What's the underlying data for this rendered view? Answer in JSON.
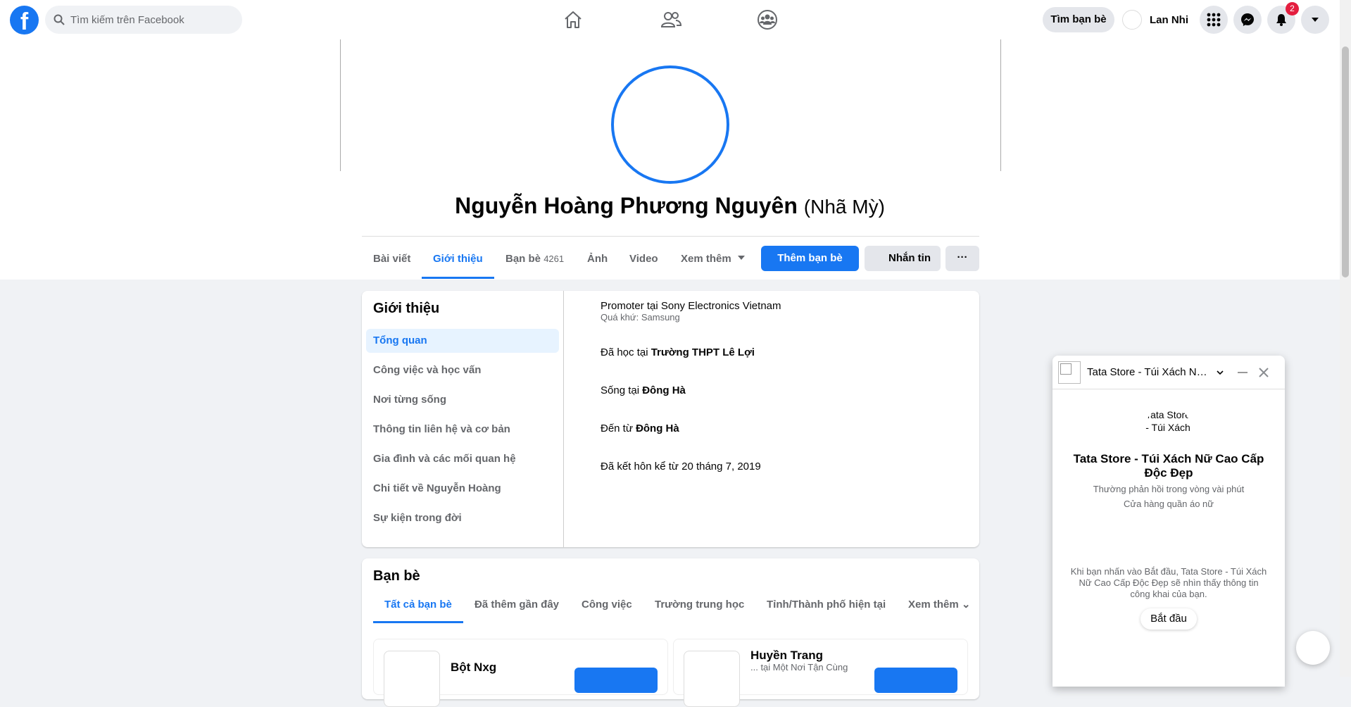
{
  "topbar": {
    "logo": "f",
    "search_placeholder": "Tìm kiếm trên Facebook",
    "find_friends": "Tìm bạn bè",
    "user_name": "Lan Nhi",
    "notification_count": "2"
  },
  "profile": {
    "name": "Nguyễn Hoàng Phương Nguyên",
    "alt_name": "(Nhã Mỳ)",
    "tabs": [
      {
        "label": "Bài viết"
      },
      {
        "label": "Giới thiệu"
      },
      {
        "label": "Bạn bè",
        "count": "4261"
      },
      {
        "label": "Ảnh"
      },
      {
        "label": "Video"
      },
      {
        "label": "Xem thêm"
      }
    ],
    "add_friend": "Thêm bạn bè",
    "message": "Nhắn tin",
    "more": "···"
  },
  "about": {
    "title": "Giới thiệu",
    "nav": [
      "Tổng quan",
      "Công việc và học vấn",
      "Nơi từng sống",
      "Thông tin liên hệ và cơ bản",
      "Gia đình và các mối quan hệ",
      "Chi tiết về Nguyễn Hoàng",
      "Sự kiện trong đời"
    ],
    "work": "Promoter tại Sony Electronics Vietnam",
    "work_past": "Quá khứ: Samsung",
    "edu_prefix": "Đã học tại ",
    "edu_place": "Trường THPT Lê Lợi",
    "live_prefix": "Sống tại ",
    "live_place": "Đông Hà",
    "from_prefix": "Đến từ ",
    "from_place": "Đông Hà",
    "relationship": "Đã kết hôn kể từ 20 tháng 7, 2019"
  },
  "friends": {
    "title": "Bạn bè",
    "tabs": [
      "Tất cả bạn bè",
      "Đã thêm gần đây",
      "Công việc",
      "Trường trung học",
      "Tỉnh/Thành phố hiện tại",
      "Xem thêm"
    ],
    "items": [
      {
        "name": "Bột Nxg",
        "sub": ""
      },
      {
        "name": "Huyền Trang",
        "sub": "... tại Một Nơi Tận Cùng"
      }
    ]
  },
  "chat": {
    "title": "Tata Store - Túi Xách Nữ Cao Cấp Độc Đẹp",
    "avatar_alt": "Tata Store - Túi Xách",
    "page_name": "Tata Store - Túi Xách Nữ Cao Cấp Độc Đẹp",
    "response_time": "Thường phản hồi trong vòng vài phút",
    "category": "Cửa hàng quần áo nữ",
    "notice": "Khi bạn nhấn vào Bắt đầu, Tata Store - Túi Xách Nữ Cao Cấp Độc Đẹp sẽ nhìn thấy thông tin công khai của bạn.",
    "start": "Bắt đầu"
  },
  "colors": {
    "accent": "#1877f2",
    "badge": "#e41e3f",
    "surface": "#f0f2f5"
  },
  "icons": [
    "facebook-logo-icon",
    "search-icon",
    "home-icon",
    "friends-icon",
    "groups-icon",
    "menu-grid-icon",
    "messenger-icon",
    "bell-icon",
    "caret-down-icon",
    "chevron-down-icon",
    "minimize-icon",
    "close-icon"
  ]
}
